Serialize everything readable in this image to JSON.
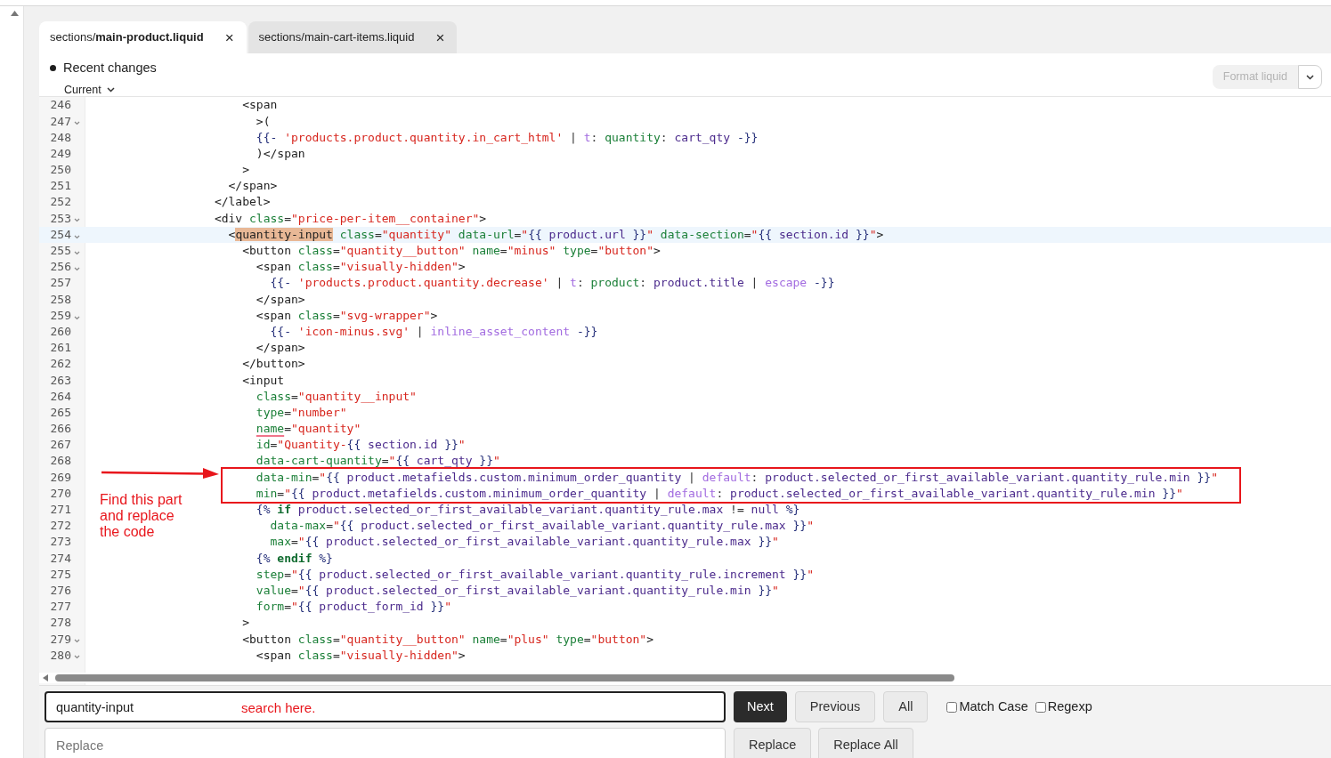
{
  "tabs": [
    {
      "prefix": "sections/",
      "name": "main-product.liquid",
      "close": "×",
      "selected": true
    },
    {
      "prefix": "sections/",
      "name": "main-cart-items.liquid",
      "close": "×",
      "selected": false
    }
  ],
  "history": {
    "label": "Recent changes",
    "version": "Current"
  },
  "format_button": {
    "label": "Format liquid",
    "disabled": true
  },
  "code": {
    "lines": [
      {
        "number": "246",
        "fold": false,
        "current": false,
        "tokens": [
          {
            "text": "                      <span",
            "kind": "tag"
          }
        ]
      },
      {
        "number": "247",
        "fold": true,
        "current": false,
        "tokens": [
          {
            "text": "                        >(",
            "kind": "tag"
          }
        ]
      },
      {
        "number": "248",
        "fold": false,
        "current": false,
        "tokens": [
          {
            "text": "                        {{-",
            "kind": "delim"
          },
          {
            "text": " 'products.product.quantity.in_cart_html'",
            "kind": "str"
          },
          {
            "text": " | ",
            "kind": "punct"
          },
          {
            "text": "t",
            "kind": "filter"
          },
          {
            "text": ": ",
            "kind": "punct"
          },
          {
            "text": "quantity",
            "kind": "attr"
          },
          {
            "text": ": ",
            "kind": "punct"
          },
          {
            "text": "cart_qty",
            "kind": "var"
          },
          {
            "text": " -}}",
            "kind": "delim"
          }
        ]
      },
      {
        "number": "249",
        "fold": false,
        "current": false,
        "tokens": [
          {
            "text": "                        )</span",
            "kind": "tag"
          }
        ]
      },
      {
        "number": "250",
        "fold": false,
        "current": false,
        "tokens": [
          {
            "text": "                      >",
            "kind": "tag"
          }
        ]
      },
      {
        "number": "251",
        "fold": false,
        "current": false,
        "tokens": [
          {
            "text": "                    </span>",
            "kind": "tag"
          }
        ]
      },
      {
        "number": "252",
        "fold": false,
        "current": false,
        "tokens": [
          {
            "text": "                  </label>",
            "kind": "tag"
          }
        ]
      },
      {
        "number": "253",
        "fold": true,
        "current": false,
        "tokens": [
          {
            "text": "                  <div",
            "kind": "tag"
          },
          {
            "text": " class",
            "kind": "attr"
          },
          {
            "text": "=",
            "kind": "punct"
          },
          {
            "text": "\"price-per-item__container\"",
            "kind": "str"
          },
          {
            "text": ">",
            "kind": "tag"
          }
        ]
      },
      {
        "number": "254",
        "fold": true,
        "current": true,
        "tokens": [
          {
            "text": "                    <",
            "kind": "tag"
          },
          {
            "text": "quantity-input",
            "kind": "match"
          },
          {
            "text": " class",
            "kind": "attr"
          },
          {
            "text": "=",
            "kind": "punct"
          },
          {
            "text": "\"quantity\"",
            "kind": "str"
          },
          {
            "text": " data-url",
            "kind": "attr"
          },
          {
            "text": "=",
            "kind": "punct"
          },
          {
            "text": "\"",
            "kind": "str"
          },
          {
            "text": "{{",
            "kind": "delim"
          },
          {
            "text": " product.url",
            "kind": "var"
          },
          {
            "text": " }}",
            "kind": "delim"
          },
          {
            "text": "\"",
            "kind": "str"
          },
          {
            "text": " data-section",
            "kind": "attr"
          },
          {
            "text": "=",
            "kind": "punct"
          },
          {
            "text": "\"",
            "kind": "str"
          },
          {
            "text": "{{",
            "kind": "delim"
          },
          {
            "text": " section.id",
            "kind": "var"
          },
          {
            "text": " }}",
            "kind": "delim"
          },
          {
            "text": "\"",
            "kind": "str"
          },
          {
            "text": ">",
            "kind": "tag"
          }
        ]
      },
      {
        "number": "255",
        "fold": true,
        "current": false,
        "tokens": [
          {
            "text": "                      <button",
            "kind": "tag"
          },
          {
            "text": " class",
            "kind": "attr"
          },
          {
            "text": "=",
            "kind": "punct"
          },
          {
            "text": "\"quantity__button\"",
            "kind": "str"
          },
          {
            "text": " name",
            "kind": "attr"
          },
          {
            "text": "=",
            "kind": "punct"
          },
          {
            "text": "\"minus\"",
            "kind": "str"
          },
          {
            "text": " type",
            "kind": "attr"
          },
          {
            "text": "=",
            "kind": "punct"
          },
          {
            "text": "\"button\"",
            "kind": "str"
          },
          {
            "text": ">",
            "kind": "tag"
          }
        ]
      },
      {
        "number": "256",
        "fold": true,
        "current": false,
        "tokens": [
          {
            "text": "                        <span",
            "kind": "tag"
          },
          {
            "text": " class",
            "kind": "attr"
          },
          {
            "text": "=",
            "kind": "punct"
          },
          {
            "text": "\"visually-hidden\"",
            "kind": "str"
          },
          {
            "text": ">",
            "kind": "tag"
          }
        ]
      },
      {
        "number": "257",
        "fold": false,
        "current": false,
        "tokens": [
          {
            "text": "                          {{-",
            "kind": "delim"
          },
          {
            "text": " 'products.product.quantity.decrease'",
            "kind": "str"
          },
          {
            "text": " | ",
            "kind": "punct"
          },
          {
            "text": "t",
            "kind": "filter"
          },
          {
            "text": ": ",
            "kind": "punct"
          },
          {
            "text": "product",
            "kind": "attr"
          },
          {
            "text": ": ",
            "kind": "punct"
          },
          {
            "text": "product.title",
            "kind": "var"
          },
          {
            "text": " | ",
            "kind": "punct"
          },
          {
            "text": "escape",
            "kind": "filter"
          },
          {
            "text": " -}}",
            "kind": "delim"
          }
        ]
      },
      {
        "number": "258",
        "fold": false,
        "current": false,
        "tokens": [
          {
            "text": "                        </span>",
            "kind": "tag"
          }
        ]
      },
      {
        "number": "259",
        "fold": true,
        "current": false,
        "tokens": [
          {
            "text": "                        <span",
            "kind": "tag"
          },
          {
            "text": " class",
            "kind": "attr"
          },
          {
            "text": "=",
            "kind": "punct"
          },
          {
            "text": "\"svg-wrapper\"",
            "kind": "str"
          },
          {
            "text": ">",
            "kind": "tag"
          }
        ]
      },
      {
        "number": "260",
        "fold": false,
        "current": false,
        "tokens": [
          {
            "text": "                          {{-",
            "kind": "delim"
          },
          {
            "text": " 'icon-minus.svg'",
            "kind": "str"
          },
          {
            "text": " | ",
            "kind": "punct"
          },
          {
            "text": "inline_asset_content",
            "kind": "filter"
          },
          {
            "text": " -}}",
            "kind": "delim"
          }
        ]
      },
      {
        "number": "261",
        "fold": false,
        "current": false,
        "tokens": [
          {
            "text": "                        </span>",
            "kind": "tag"
          }
        ]
      },
      {
        "number": "262",
        "fold": false,
        "current": false,
        "tokens": [
          {
            "text": "                      </button>",
            "kind": "tag"
          }
        ]
      },
      {
        "number": "263",
        "fold": false,
        "current": false,
        "tokens": [
          {
            "text": "                      <input",
            "kind": "tag"
          }
        ]
      },
      {
        "number": "264",
        "fold": false,
        "current": false,
        "tokens": [
          {
            "text": "                        class",
            "kind": "attr"
          },
          {
            "text": "=",
            "kind": "punct"
          },
          {
            "text": "\"quantity__input\"",
            "kind": "str"
          }
        ]
      },
      {
        "number": "265",
        "fold": false,
        "current": false,
        "tokens": [
          {
            "text": "                        type",
            "kind": "attr"
          },
          {
            "text": "=",
            "kind": "punct"
          },
          {
            "text": "\"number\"",
            "kind": "str"
          }
        ]
      },
      {
        "number": "266",
        "fold": false,
        "current": false,
        "tokens": [
          {
            "text": "                        name",
            "kind": "warn"
          },
          {
            "text": "=",
            "kind": "punct"
          },
          {
            "text": "\"quantity\"",
            "kind": "str"
          }
        ]
      },
      {
        "number": "267",
        "fold": false,
        "current": false,
        "tokens": [
          {
            "text": "                        id",
            "kind": "attr"
          },
          {
            "text": "=",
            "kind": "punct"
          },
          {
            "text": "\"Quantity-",
            "kind": "str"
          },
          {
            "text": "{{",
            "kind": "delim"
          },
          {
            "text": " section.id",
            "kind": "var"
          },
          {
            "text": " }}",
            "kind": "delim"
          },
          {
            "text": "\"",
            "kind": "str"
          }
        ]
      },
      {
        "number": "268",
        "fold": false,
        "current": false,
        "tokens": [
          {
            "text": "                        data-cart-quantity",
            "kind": "attr"
          },
          {
            "text": "=",
            "kind": "punct"
          },
          {
            "text": "\"",
            "kind": "str"
          },
          {
            "text": "{{",
            "kind": "delim"
          },
          {
            "text": " cart_qty",
            "kind": "var"
          },
          {
            "text": " }}",
            "kind": "delim"
          },
          {
            "text": "\"",
            "kind": "str"
          }
        ]
      },
      {
        "number": "269",
        "fold": false,
        "current": false,
        "tokens": [
          {
            "text": "                        data-min",
            "kind": "attr"
          },
          {
            "text": "=",
            "kind": "punct"
          },
          {
            "text": "\"",
            "kind": "str"
          },
          {
            "text": "{{",
            "kind": "delim"
          },
          {
            "text": " product.metafields.custom.minimum_order_quantity",
            "kind": "var"
          },
          {
            "text": " | ",
            "kind": "punct"
          },
          {
            "text": "default",
            "kind": "filter"
          },
          {
            "text": ": ",
            "kind": "punct"
          },
          {
            "text": "product.selected_or_first_available_variant.quantity_rule.min",
            "kind": "var"
          },
          {
            "text": " }}",
            "kind": "delim"
          },
          {
            "text": "\"",
            "kind": "str"
          }
        ]
      },
      {
        "number": "270",
        "fold": false,
        "current": false,
        "tokens": [
          {
            "text": "                        min",
            "kind": "attr"
          },
          {
            "text": "=",
            "kind": "punct"
          },
          {
            "text": "\"",
            "kind": "str"
          },
          {
            "text": "{{",
            "kind": "delim"
          },
          {
            "text": " product.metafields.custom.minimum_order_quantity",
            "kind": "var"
          },
          {
            "text": " | ",
            "kind": "punct"
          },
          {
            "text": "default",
            "kind": "filter"
          },
          {
            "text": ": ",
            "kind": "punct"
          },
          {
            "text": "product.selected_or_first_available_variant.quantity_rule.min",
            "kind": "var"
          },
          {
            "text": " }}",
            "kind": "delim"
          },
          {
            "text": "\"",
            "kind": "str"
          }
        ]
      },
      {
        "number": "271",
        "fold": false,
        "current": false,
        "tokens": [
          {
            "text": "                        {%",
            "kind": "delim"
          },
          {
            "text": " if",
            "kind": "kw"
          },
          {
            "text": " product.selected_or_first_available_variant.quantity_rule.max",
            "kind": "var"
          },
          {
            "text": " != ",
            "kind": "punct"
          },
          {
            "text": "null",
            "kind": "var"
          },
          {
            "text": " %}",
            "kind": "delim"
          }
        ]
      },
      {
        "number": "272",
        "fold": false,
        "current": false,
        "tokens": [
          {
            "text": "                          data-max",
            "kind": "attr"
          },
          {
            "text": "=",
            "kind": "punct"
          },
          {
            "text": "\"",
            "kind": "str"
          },
          {
            "text": "{{",
            "kind": "delim"
          },
          {
            "text": " product.selected_or_first_available_variant.quantity_rule.max",
            "kind": "var"
          },
          {
            "text": " }}",
            "kind": "delim"
          },
          {
            "text": "\"",
            "kind": "str"
          }
        ]
      },
      {
        "number": "273",
        "fold": false,
        "current": false,
        "tokens": [
          {
            "text": "                          max",
            "kind": "attr"
          },
          {
            "text": "=",
            "kind": "punct"
          },
          {
            "text": "\"",
            "kind": "str"
          },
          {
            "text": "{{",
            "kind": "delim"
          },
          {
            "text": " product.selected_or_first_available_variant.quantity_rule.max",
            "kind": "var"
          },
          {
            "text": " }}",
            "kind": "delim"
          },
          {
            "text": "\"",
            "kind": "str"
          }
        ]
      },
      {
        "number": "274",
        "fold": false,
        "current": false,
        "tokens": [
          {
            "text": "                        {%",
            "kind": "delim"
          },
          {
            "text": " endif",
            "kind": "kw"
          },
          {
            "text": " %}",
            "kind": "delim"
          }
        ]
      },
      {
        "number": "275",
        "fold": false,
        "current": false,
        "tokens": [
          {
            "text": "                        step",
            "kind": "attr"
          },
          {
            "text": "=",
            "kind": "punct"
          },
          {
            "text": "\"",
            "kind": "str"
          },
          {
            "text": "{{",
            "kind": "delim"
          },
          {
            "text": " product.selected_or_first_available_variant.quantity_rule.increment",
            "kind": "var"
          },
          {
            "text": " }}",
            "kind": "delim"
          },
          {
            "text": "\"",
            "kind": "str"
          }
        ]
      },
      {
        "number": "276",
        "fold": false,
        "current": false,
        "tokens": [
          {
            "text": "                        value",
            "kind": "attr"
          },
          {
            "text": "=",
            "kind": "punct"
          },
          {
            "text": "\"",
            "kind": "str"
          },
          {
            "text": "{{",
            "kind": "delim"
          },
          {
            "text": " product.selected_or_first_available_variant.quantity_rule.min",
            "kind": "var"
          },
          {
            "text": " }}",
            "kind": "delim"
          },
          {
            "text": "\"",
            "kind": "str"
          }
        ]
      },
      {
        "number": "277",
        "fold": false,
        "current": false,
        "tokens": [
          {
            "text": "                        form",
            "kind": "attr"
          },
          {
            "text": "=",
            "kind": "punct"
          },
          {
            "text": "\"",
            "kind": "str"
          },
          {
            "text": "{{",
            "kind": "delim"
          },
          {
            "text": " product_form_id",
            "kind": "var"
          },
          {
            "text": " }}",
            "kind": "delim"
          },
          {
            "text": "\"",
            "kind": "str"
          }
        ]
      },
      {
        "number": "278",
        "fold": false,
        "current": false,
        "tokens": [
          {
            "text": "                      >",
            "kind": "tag"
          }
        ]
      },
      {
        "number": "279",
        "fold": true,
        "current": false,
        "tokens": [
          {
            "text": "                      <button",
            "kind": "tag"
          },
          {
            "text": " class",
            "kind": "attr"
          },
          {
            "text": "=",
            "kind": "punct"
          },
          {
            "text": "\"quantity__button\"",
            "kind": "str"
          },
          {
            "text": " name",
            "kind": "attr"
          },
          {
            "text": "=",
            "kind": "punct"
          },
          {
            "text": "\"plus\"",
            "kind": "str"
          },
          {
            "text": " type",
            "kind": "attr"
          },
          {
            "text": "=",
            "kind": "punct"
          },
          {
            "text": "\"button\"",
            "kind": "str"
          },
          {
            "text": ">",
            "kind": "tag"
          }
        ]
      },
      {
        "number": "280",
        "fold": true,
        "current": false,
        "tokens": [
          {
            "text": "                        <span",
            "kind": "tag"
          },
          {
            "text": " class",
            "kind": "attr"
          },
          {
            "text": "=",
            "kind": "punct"
          },
          {
            "text": "\"visually-hidden\"",
            "kind": "str"
          },
          {
            "text": ">",
            "kind": "tag"
          }
        ]
      }
    ]
  },
  "annotations": [
    {
      "kind": "box"
    },
    {
      "kind": "arrow"
    },
    {
      "kind": "note",
      "text": "Find this part and replace the code"
    }
  ],
  "find": {
    "search": {
      "value": "quantity-input",
      "note": "search here."
    },
    "buttons": [
      {
        "label": "Next",
        "primary": true
      },
      {
        "label": "Previous",
        "primary": false
      },
      {
        "label": "All",
        "primary": false
      }
    ],
    "options": [
      {
        "label": "Match Case",
        "checked": false
      },
      {
        "label": "Regexp",
        "checked": false
      }
    ],
    "replace": {
      "placeholder": "Replace"
    },
    "replace_buttons": [
      "Replace",
      "Replace All"
    ]
  }
}
